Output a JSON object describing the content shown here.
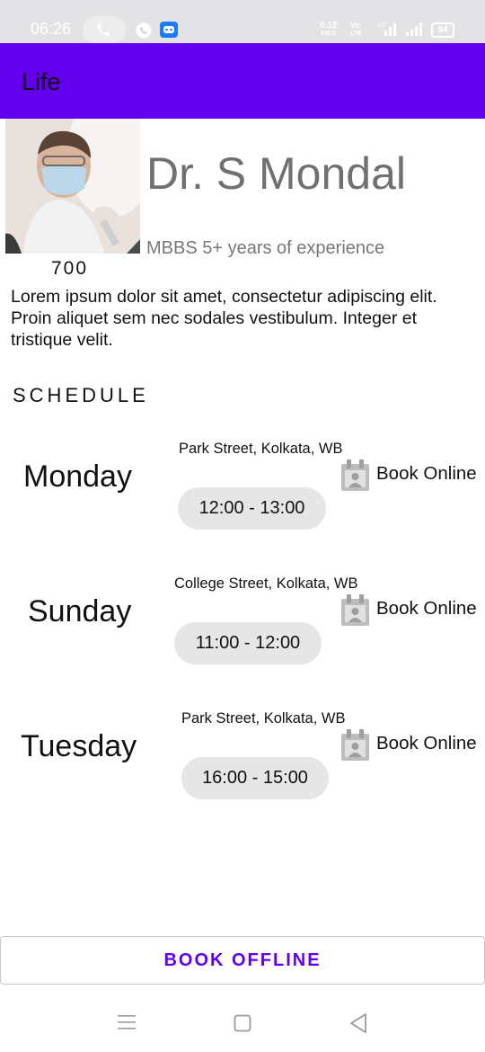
{
  "status_bar": {
    "time": "06:26",
    "net_speed_value": "0.12",
    "net_speed_unit": "KB/S",
    "volte_top": "Vo",
    "volte_bottom": "LTE",
    "network_type": "4G",
    "battery": "94",
    "icons": [
      "phone-icon",
      "whatsapp-icon",
      "discord-icon",
      "signal-icon",
      "battery-icon"
    ]
  },
  "app_bar": {
    "title": "Life",
    "color": "#6200ee"
  },
  "doctor": {
    "name": "Dr. S Mondal",
    "qualification": "MBBS 5+ years of experience",
    "fee": "700",
    "description": "Lorem ipsum dolor sit amet, consectetur adipiscing elit. Proin aliquet sem nec sodales vestibulum. Integer et tristique velit."
  },
  "schedule": {
    "heading": "SCHEDULE",
    "book_online_label": "Book Online",
    "items": [
      {
        "day": "Monday",
        "place": "Park Street, Kolkata, WB",
        "time": "12:00 - 13:00"
      },
      {
        "day": "Sunday",
        "place": "College Street, Kolkata, WB",
        "time": "11:00 - 12:00"
      },
      {
        "day": "Tuesday",
        "place": "Park Street, Kolkata, WB",
        "time": "16:00 - 15:00"
      }
    ]
  },
  "book_offline_label": "BOOK OFFLINE",
  "nav_bar": {
    "icons": [
      "menu-icon",
      "home-icon",
      "back-icon"
    ]
  }
}
